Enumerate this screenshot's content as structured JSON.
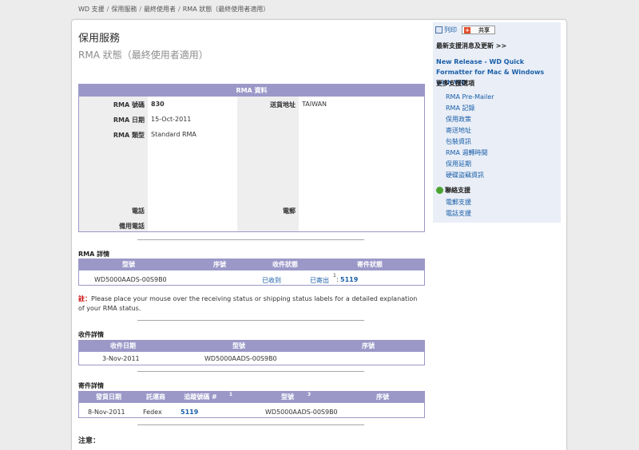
{
  "breadcrumb": [
    "WD 支援",
    "保用服務",
    "最終使用者",
    "RMA 狀態（最終使用者適用）"
  ],
  "page": {
    "title": "保用服務",
    "subtitle": "RMA 狀態（最終使用者適用）"
  },
  "rma_info": {
    "header": "RMA 資料",
    "rma_number_label": "RMA 號碼",
    "rma_number": "830",
    "rma_date_label": "RMA 日期",
    "rma_date": "15-Oct-2011",
    "rma_type_label": "RMA 類型",
    "rma_type": "Standard RMA",
    "ship_address_label": "送貨地址",
    "ship_address": "TAIWAN",
    "phone_label": "電話",
    "alt_phone_label": "備用電話",
    "email_label": "電郵"
  },
  "rma_details": {
    "title": "RMA 詳情",
    "headers": [
      "型號",
      "序號",
      "收件狀態",
      "寄件狀態"
    ],
    "row": {
      "model": "WD5000AADS-00S9B0",
      "receive_status": "已收到",
      "ship_status": "已寄出",
      "ship_sup": "1",
      "ship_number": "5119"
    }
  },
  "note": {
    "mark": "註：",
    "text": "Please place your mouse over the receiving status or shipping status labels for a detailed explanation of your RMA status."
  },
  "receipt_details": {
    "title": "收件詳情",
    "headers": [
      "收件日期",
      "型號",
      "序號"
    ],
    "row": {
      "date": "3-Nov-2011",
      "model": "WD5000AADS-00S9B0"
    }
  },
  "shipment_details": {
    "title": "寄件詳情",
    "headers": [
      "發貨日期",
      "託運商",
      "追蹤號碼 #",
      "型號",
      "序號"
    ],
    "sup_tracking": "1",
    "sup_model": "3",
    "row": {
      "date": "8-Nov-2011",
      "carrier": "Fedex",
      "tracking": "5119",
      "model": "WD5000AADS-00S9B0"
    }
  },
  "footer_note": "注意：",
  "sidebar": {
    "print": "列印",
    "share": "共享",
    "latest_news_heading": "最新支援消息及更新 >>",
    "news_link": "New Release - WD Quick Formatter for Mac & Windows with WD",
    "more_options_heading": "更多支援選項",
    "links": [
      "RMA Pre-Mailer",
      "RMA 記錄",
      "保用政策",
      "寄送地址",
      "包裝資訊",
      "RMA 週轉時間",
      "保用延期",
      "硬碟盜竊資訊"
    ],
    "contact_title": "聯絡支援",
    "contact_links": [
      "電郵支援",
      "電話支援"
    ]
  }
}
